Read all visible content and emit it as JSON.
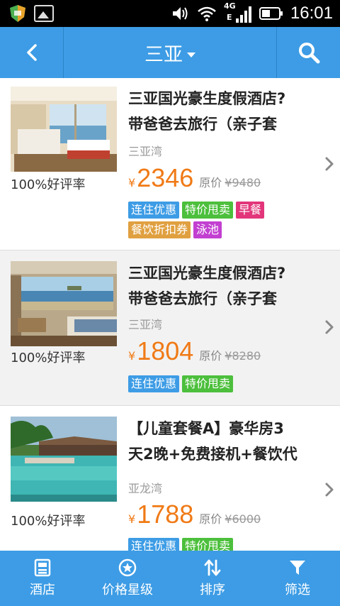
{
  "status_bar": {
    "time": "16:01",
    "network": "4G",
    "network_sub": "E"
  },
  "nav": {
    "title": "三亚"
  },
  "hotels": [
    {
      "title_line1": "三亚国光豪生度假酒店?",
      "title_line2": "带爸爸去旅行（亲子套",
      "area": "三亚湾",
      "rating": "100%好评率",
      "currency": "¥",
      "price": "2346",
      "orig_label": "原价",
      "orig_price": "¥9480",
      "tags": [
        {
          "label": "连住优惠",
          "color": "#3d9ce5"
        },
        {
          "label": "特价甩卖",
          "color": "#4cbf3c"
        },
        {
          "label": "早餐",
          "color": "#e2357a"
        },
        {
          "label": "餐饮折扣券",
          "color": "#e0a040"
        },
        {
          "label": "泳池",
          "color": "#c23fd1"
        }
      ]
    },
    {
      "title_line1": "三亚国光豪生度假酒店?",
      "title_line2": "带爸爸去旅行（亲子套",
      "area": "三亚湾",
      "rating": "100%好评率",
      "currency": "¥",
      "price": "1804",
      "orig_label": "原价",
      "orig_price": "¥8280",
      "tags": [
        {
          "label": "连住优惠",
          "color": "#3d9ce5"
        },
        {
          "label": "特价甩卖",
          "color": "#4cbf3c"
        }
      ]
    },
    {
      "title_line1": "【儿童套餐A】豪华房3",
      "title_line2": "天2晚+免费接机+餐饮代",
      "area": "亚龙湾",
      "rating": "100%好评率",
      "currency": "¥",
      "price": "1788",
      "orig_label": "原价",
      "orig_price": "¥6000",
      "tags": [
        {
          "label": "连住优惠",
          "color": "#3d9ce5"
        },
        {
          "label": "特价甩卖",
          "color": "#4cbf3c"
        }
      ]
    }
  ],
  "tabbar": {
    "hotel": "酒店",
    "price_star": "价格星级",
    "sort": "排序",
    "filter": "筛选"
  }
}
